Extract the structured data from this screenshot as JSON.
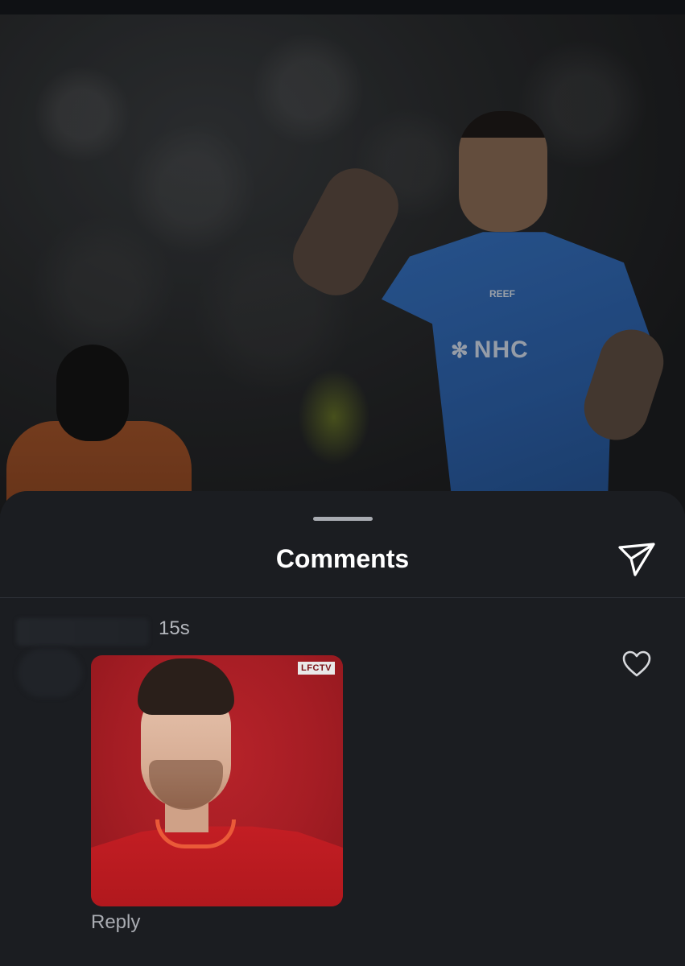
{
  "background_photo": {
    "sponsor_text": "NHC",
    "crest_text": "REEF"
  },
  "sheet": {
    "title": "Comments",
    "share_icon": "send-icon"
  },
  "comment": {
    "timestamp": "15s",
    "gif_badge": "LFCTV",
    "like_icon": "heart-icon",
    "reply_label": "Reply"
  }
}
